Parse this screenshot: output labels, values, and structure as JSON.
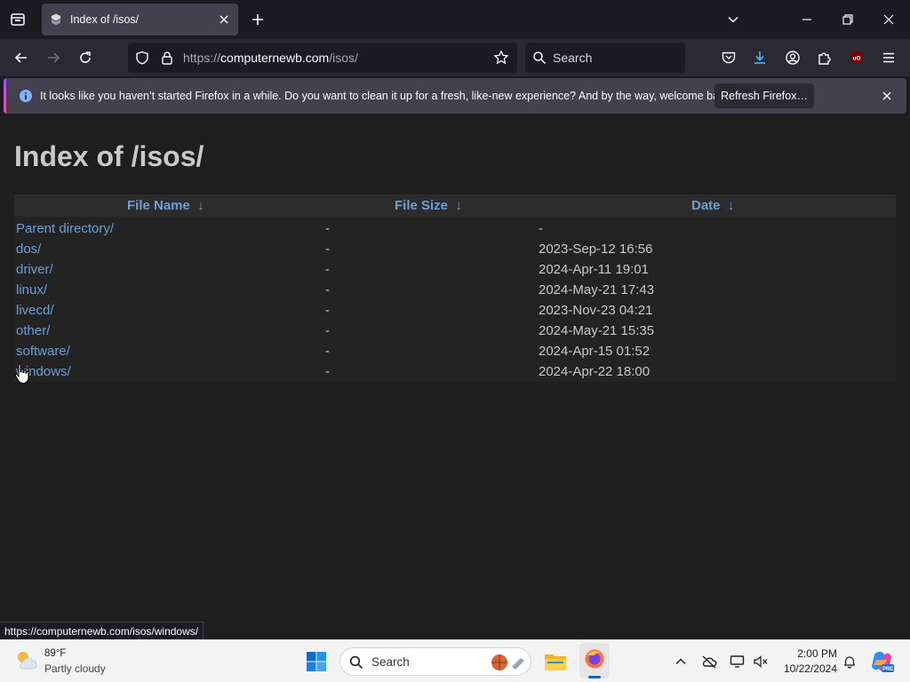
{
  "browser": {
    "tab": {
      "title": "Index of /isos/"
    },
    "url": {
      "scheme": "https://",
      "host": "computernewb.com",
      "path": "/isos/"
    },
    "search_placeholder": "Search",
    "notification": {
      "message": "It looks like you haven’t started Firefox in a while. Do you want to clean it up for a fresh, like-new experience? And by the way, welcome back!",
      "button_label": "Refresh Firefox…"
    },
    "status_url": "https://computernewb.com/isos/windows/",
    "accent": "#3fbcff",
    "extension_badge": "uO"
  },
  "page": {
    "title": "Index of /isos/",
    "columns": [
      {
        "label": "File Name",
        "sort": "↓"
      },
      {
        "label": "File Size",
        "sort": "↓"
      },
      {
        "label": "Date",
        "sort": "↓"
      }
    ],
    "rows": [
      {
        "name": "Parent directory/",
        "size": "-",
        "date": "-"
      },
      {
        "name": "dos/",
        "size": "-",
        "date": "2023-Sep-12 16:56"
      },
      {
        "name": "driver/",
        "size": "-",
        "date": "2024-Apr-11 19:01"
      },
      {
        "name": "linux/",
        "size": "-",
        "date": "2024-May-21 17:43"
      },
      {
        "name": "livecd/",
        "size": "-",
        "date": "2023-Nov-23 04:21"
      },
      {
        "name": "other/",
        "size": "-",
        "date": "2024-May-21 15:35"
      },
      {
        "name": "software/",
        "size": "-",
        "date": "2024-Apr-15 01:52"
      },
      {
        "name": "windows/",
        "size": "-",
        "date": "2024-Apr-22 18:00"
      }
    ],
    "link_color": "#6a9fd8"
  },
  "taskbar": {
    "weather": {
      "temp": "89°F",
      "desc": "Partly cloudy"
    },
    "search_placeholder": "Search",
    "clock": {
      "time": "2:00 PM",
      "date": "10/22/2024"
    },
    "copilot_badge": "PRE"
  }
}
